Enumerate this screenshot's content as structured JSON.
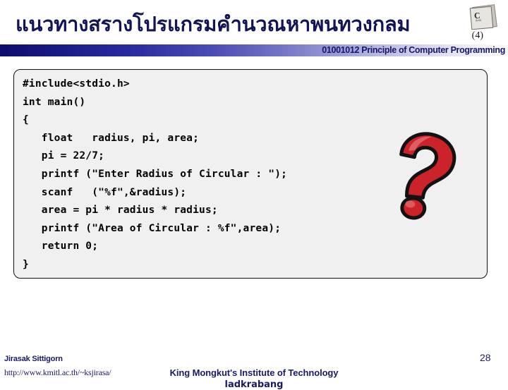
{
  "header": {
    "title_thai": "แนวทางสรางโปรแกรมคำนวณหาพนทวงกลม",
    "slide_variant": "(4)",
    "course_subtitle": "01001012 Principle of Computer Programming",
    "logo_label": "C",
    "logo_sublabel": "data",
    "rule_color_start": "#0d0d6b",
    "rule_color_end": "#ffffff",
    "title_color": "#131358"
  },
  "code_box": {
    "background": "#f0f0f0",
    "border_color": "#111111",
    "listing": "#include<stdio.h>\nint main()\n{\n   float   radius, pi, area;\n   pi = 22/7;\n   printf (\"Enter Radius of Circular : \");\n   scanf   (\"%f\",&radius);\n   area = pi * radius * radius;\n   printf (\"Area of Circular : %f\",area);\n   return 0;\n}",
    "lines": [
      "#include<stdio.h>",
      "int main()",
      "{",
      "   float   radius, pi, area;",
      "   pi = 22/7;",
      "   printf (\"Enter Radius of Circular : \");",
      "   scanf   (\"%f\",&radius);",
      "   area = pi * radius * radius;",
      "   printf (\"Area of Circular : %f\",area);",
      "   return 0;",
      "}"
    ]
  },
  "graphic": {
    "name": "question-mark",
    "fill_color": "#cc2229",
    "highlight_color": "#e0545a",
    "outline_color": "#111111"
  },
  "footer": {
    "author": "Jirasak Sittigorn",
    "url": "http://www.kmitl.ac.th/~ksjirasa/",
    "page_number": "28",
    "institution_line1": "King Mongkut's Institute of Technology",
    "institution_line2": "ladkrabang",
    "text_color": "#191964"
  }
}
